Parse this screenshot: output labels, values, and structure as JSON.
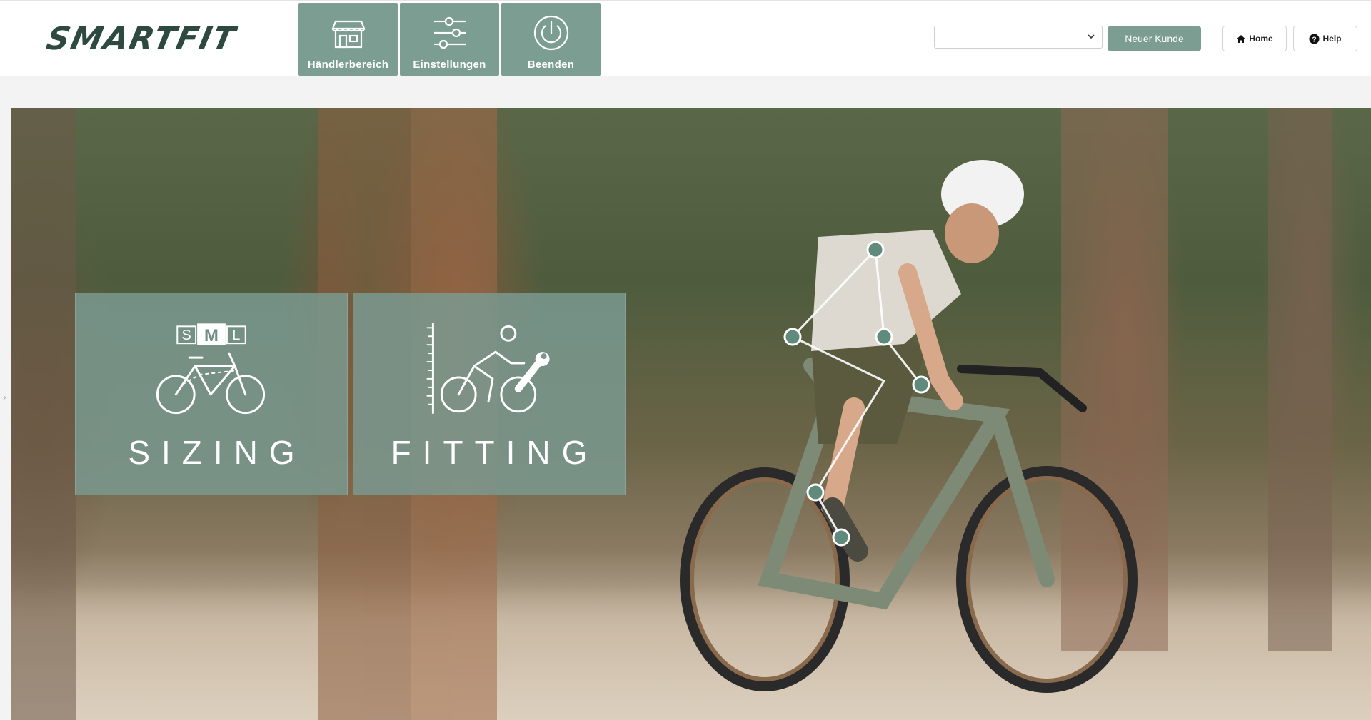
{
  "header": {
    "logo_text": "SMARTFIT",
    "nav": [
      {
        "label": "Händlerbereich",
        "icon": "store-icon"
      },
      {
        "label": "Einstellungen",
        "icon": "sliders-icon"
      },
      {
        "label": "Beenden",
        "icon": "power-icon"
      }
    ],
    "customer_select": {
      "value": ""
    },
    "new_customer_label": "Neuer Kunde",
    "home_label": "Home",
    "help_label": "Help"
  },
  "hero": {
    "tiles": [
      {
        "label": "SIZING",
        "icon": "bike-size-icon",
        "size_letters": [
          "S",
          "M",
          "L"
        ]
      },
      {
        "label": "FITTING",
        "icon": "bike-fit-icon"
      }
    ],
    "background": "cyclist-gravel-bike-photo"
  },
  "colors": {
    "accent": "#7c9d92",
    "logo": "#2e4a40",
    "tile": "#7a998f"
  }
}
